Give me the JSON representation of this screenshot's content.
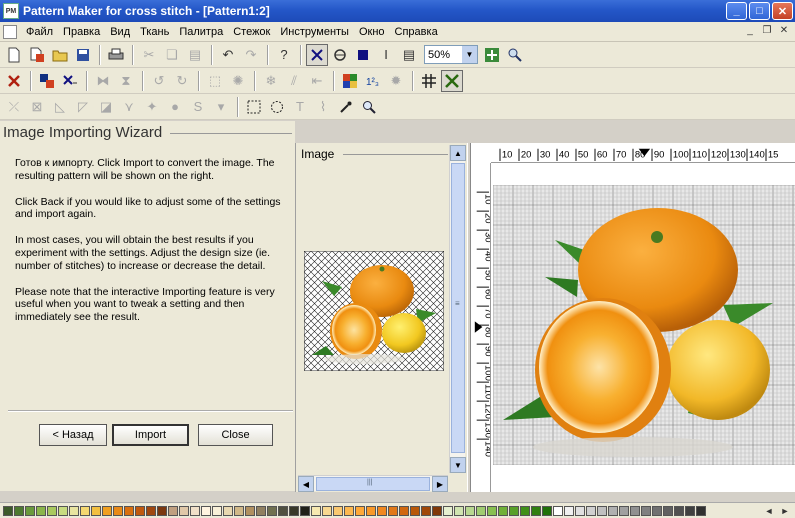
{
  "window": {
    "title": "Pattern Maker for cross stitch - [Pattern1:2]",
    "app_icon_text": "PM",
    "minimize": "_",
    "maximize": "□",
    "close": "✕"
  },
  "menu": {
    "items": [
      "Файл",
      "Правка",
      "Вид",
      "Ткань",
      "Палитра",
      "Стежок",
      "Инструменты",
      "Окно",
      "Справка"
    ],
    "mdi_minimize": "_",
    "mdi_restore": "❐",
    "mdi_close": "✕"
  },
  "toolbar": {
    "zoom_value": "50%",
    "zoom_arrow": "▼"
  },
  "wizard": {
    "title": "Image Importing Wizard",
    "paragraphs": [
      "Готов к импорту.  Click Import to convert the image. The resulting pattern will be shown on the right.",
      "Click Back if you would like to adjust some of the settings and import again.",
      "In most cases, you will obtain the best results if you experiment with the settings.  Adjust the design size (ie. number of stitches) to increase or decrease the detail.",
      "Please note that the interactive Importing feature is very useful when you want to tweak a setting and then immediately see the result."
    ],
    "back_label": "< Назад",
    "import_label": "Import",
    "cancel_label": "Close"
  },
  "preview": {
    "label": "Image",
    "scroll_up": "▲",
    "scroll_down": "▼",
    "scroll_left": "◀",
    "scroll_right": "▶",
    "scroll_grip": "≡",
    "hscroll_grip": "|||"
  },
  "ruler": {
    "top_ticks": [
      "10",
      "20",
      "30",
      "40",
      "50",
      "60",
      "70",
      "80",
      "90",
      "100",
      "110",
      "120",
      "130",
      "140",
      "15"
    ],
    "left_ticks": [
      "10",
      "20",
      "30",
      "40",
      "50",
      "60",
      "70",
      "80",
      "90",
      "100",
      "110",
      "120",
      "130",
      "140"
    ]
  },
  "palette": {
    "colors": [
      "#3d5a2a",
      "#4e7a30",
      "#6a9a3c",
      "#8bb54a",
      "#a9c95e",
      "#c8dc80",
      "#e8e4a0",
      "#f4d870",
      "#f2c040",
      "#f0a020",
      "#e88a18",
      "#d87010",
      "#c05a10",
      "#a04810",
      "#7a3810",
      "#c0a080",
      "#e0c8a8",
      "#f0e0c8",
      "#fff4e0",
      "#f8f0d8",
      "#e8d8b0",
      "#d0b888",
      "#b09060",
      "#908060",
      "#707050",
      "#505040",
      "#383828",
      "#202018",
      "#f6e8b0",
      "#f8d890",
      "#fac870",
      "#fcb850",
      "#fea838",
      "#f89828",
      "#f08820",
      "#e07818",
      "#d06810",
      "#b85808",
      "#a04808",
      "#803808",
      "#e6f0d0",
      "#d0e4b0",
      "#b8d890",
      "#a0cc70",
      "#88c050",
      "#70b038",
      "#58a028",
      "#409018",
      "#308010",
      "#207008",
      "#fff",
      "#f0f0f0",
      "#e0e0e0",
      "#d0d0d0",
      "#c0c0c0",
      "#b0b0b0",
      "#a0a0a0",
      "#909090",
      "#808080",
      "#707070",
      "#606060",
      "#505050",
      "#404040",
      "#303030"
    ],
    "nav_left": "◄",
    "nav_right": "►"
  }
}
